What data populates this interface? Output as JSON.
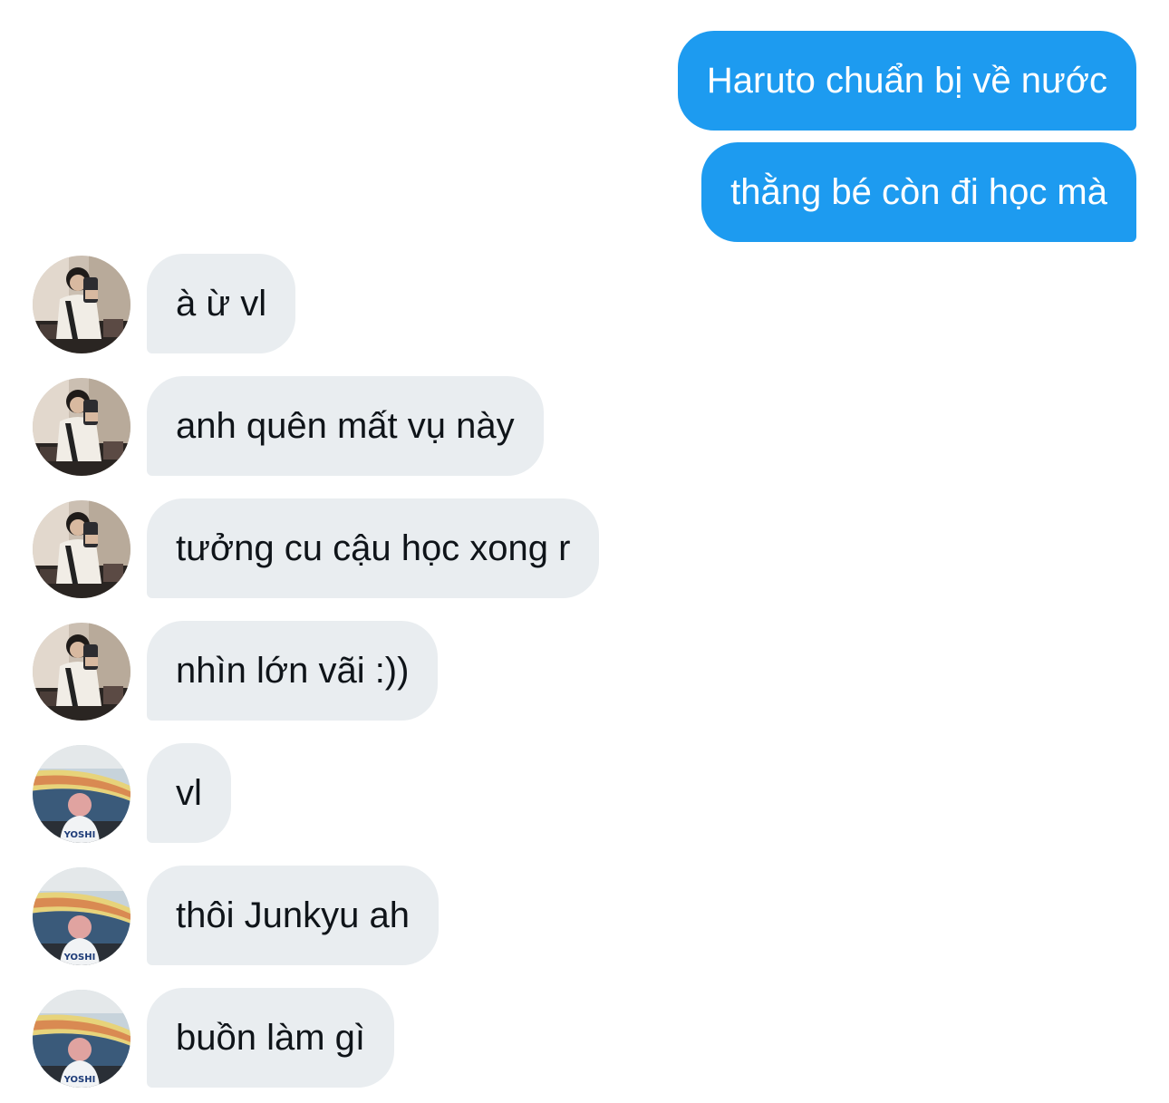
{
  "conversation": {
    "messages": [
      {
        "sender": "me",
        "text": "Haruto chuẩn bị về nước"
      },
      {
        "sender": "me",
        "text": "thằng bé còn đi học mà"
      },
      {
        "sender": "contact_a",
        "text": "à ừ vl"
      },
      {
        "sender": "contact_a",
        "text": "anh quên mất vụ này"
      },
      {
        "sender": "contact_a",
        "text": "tưởng cu cậu học xong r"
      },
      {
        "sender": "contact_a",
        "text": "nhìn lớn vãi :))"
      },
      {
        "sender": "contact_b",
        "text": "vl"
      },
      {
        "sender": "contact_b",
        "text": "thôi Junkyu ah"
      },
      {
        "sender": "contact_b",
        "text": "buồn làm gì"
      }
    ],
    "avatars": {
      "contact_a": {
        "icon": "mirror-selfie-avatar"
      },
      "contact_b": {
        "icon": "stadium-photo-avatar",
        "shirt_text": "YOSHI"
      }
    }
  },
  "colors": {
    "outgoing_bubble": "#1d9bf0",
    "incoming_bubble": "#e9edf0",
    "outgoing_text": "#ffffff",
    "incoming_text": "#0f1419"
  }
}
